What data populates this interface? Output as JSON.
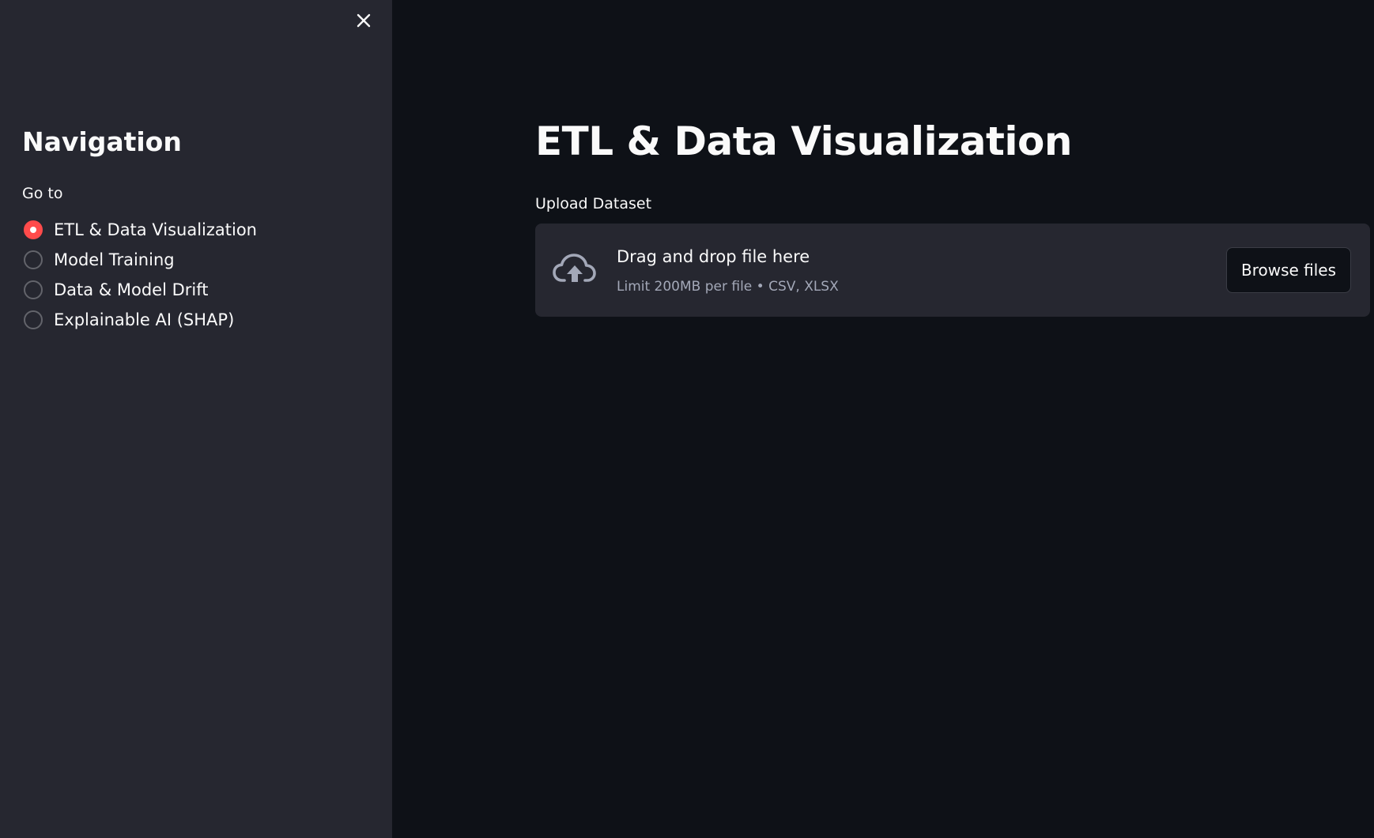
{
  "sidebar": {
    "close_icon": "close-icon",
    "title": "Navigation",
    "radio_label": "Go to",
    "options": [
      {
        "label": "ETL & Data Visualization",
        "selected": true
      },
      {
        "label": "Model Training",
        "selected": false
      },
      {
        "label": "Data & Model Drift",
        "selected": false
      },
      {
        "label": "Explainable AI (SHAP)",
        "selected": false
      }
    ]
  },
  "main": {
    "title": "ETL & Data Visualization",
    "uploader": {
      "label": "Upload Dataset",
      "icon": "cloud-upload-icon",
      "drop_text": "Drag and drop file here",
      "limit_text": "Limit 200MB per file • CSV, XLSX",
      "button_label": "Browse files"
    }
  },
  "colors": {
    "background": "#0e1117",
    "sidebar_background": "#262730",
    "accent": "#ff4b4b",
    "text": "#fafafa",
    "muted_text": "#a3a8b8"
  }
}
